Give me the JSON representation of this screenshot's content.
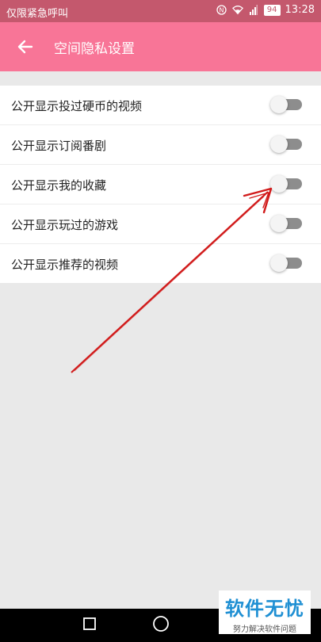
{
  "status_bar": {
    "carrier": "仅限紧急呼叫",
    "battery": "94",
    "time": "13:28"
  },
  "app_bar": {
    "title": "空间隐私设置"
  },
  "settings": [
    {
      "label": "公开显示投过硬币的视频",
      "enabled": false
    },
    {
      "label": "公开显示订阅番剧",
      "enabled": false
    },
    {
      "label": "公开显示我的收藏",
      "enabled": false
    },
    {
      "label": "公开显示玩过的游戏",
      "enabled": false
    },
    {
      "label": "公开显示推荐的视频",
      "enabled": false
    }
  ],
  "watermark": {
    "title": "软件无忧",
    "subtitle": "努力解决软件问题"
  },
  "colors": {
    "status_bar": "#c4586d",
    "app_bar": "#f87597",
    "annotation_arrow": "#d11a1a",
    "watermark_text": "#1e8fd3"
  },
  "icons": [
    "back-arrow-icon",
    "wifi-icon",
    "signal-icon",
    "battery-icon",
    "recents-icon",
    "home-icon"
  ]
}
